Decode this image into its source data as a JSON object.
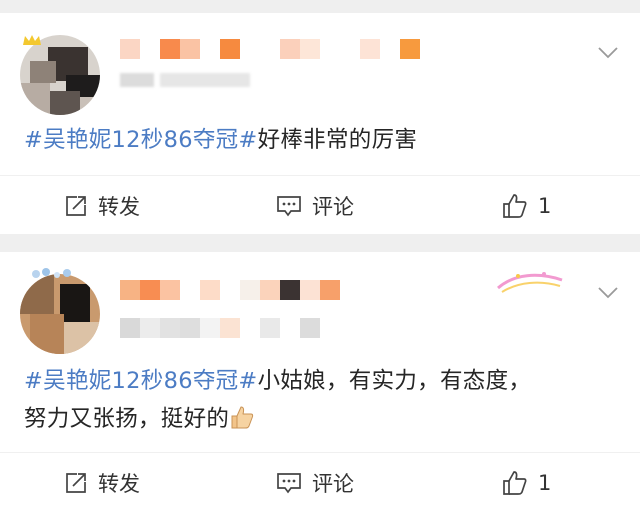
{
  "posts": [
    {
      "content": {
        "topic": "#吴艳妮12秒86夺冠#",
        "text": "好棒非常的厉害",
        "text_line2": ""
      },
      "actions": {
        "repost_label": "转发",
        "comment_label": "评论",
        "like_count": "1"
      },
      "icons": [
        "edit-share-icon",
        "comment-icon",
        "thumbs-up-icon",
        "chevron-down-icon"
      ]
    },
    {
      "content": {
        "topic": "#吴艳妮12秒86夺冠#",
        "text": "小姑娘，有实力，有态度，",
        "text_line2": "努力又张扬，挺好的"
      },
      "actions": {
        "repost_label": "转发",
        "comment_label": "评论",
        "like_count": "1"
      },
      "icons": [
        "edit-share-icon",
        "comment-icon",
        "thumbs-up-icon",
        "chevron-down-icon",
        "thumbs-up-emoji-icon"
      ]
    }
  ],
  "colors": {
    "topic": "#4c7cc4",
    "text": "#262626",
    "background": "#efefef",
    "card": "#ffffff"
  }
}
